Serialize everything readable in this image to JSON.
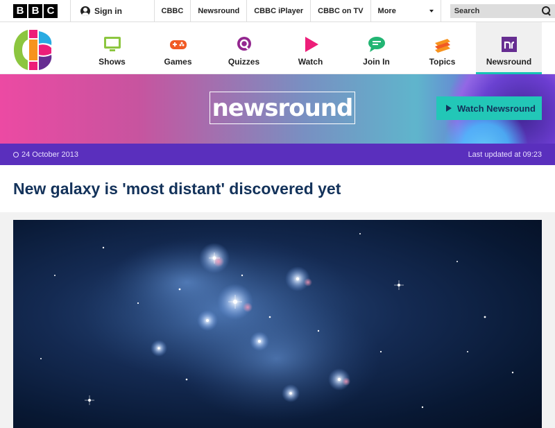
{
  "bbc": {
    "letters": [
      "B",
      "B",
      "C"
    ],
    "signin": "Sign in"
  },
  "topnav": [
    "CBBC",
    "Newsround",
    "CBBC iPlayer",
    "CBBC on TV"
  ],
  "more_label": "More",
  "search_label": "Search",
  "cbbc_nav": [
    {
      "label": "Shows",
      "icon": "tv-icon",
      "color": "#8cc63f"
    },
    {
      "label": "Games",
      "icon": "gamepad-icon",
      "color": "#f15a24"
    },
    {
      "label": "Quizzes",
      "icon": "quiz-icon",
      "color": "#93278f"
    },
    {
      "label": "Watch",
      "icon": "play-icon",
      "color": "#ed1e79"
    },
    {
      "label": "Join In",
      "icon": "chat-icon",
      "color": "#22b573"
    },
    {
      "label": "Topics",
      "icon": "layers-icon",
      "color": "#f7931e"
    },
    {
      "label": "Newsround",
      "icon": "newsround-icon",
      "color": "#662d91"
    }
  ],
  "banner": {
    "logo_text": "newsround",
    "watch_label": "Watch Newsround"
  },
  "date_bar": {
    "date": "24 October 2013",
    "updated": "Last updated at 09:23"
  },
  "article": {
    "headline": "New galaxy is 'most distant' discovered yet"
  },
  "colors": {
    "accent": "#22c7b7",
    "date_bar": "#5a2fbd",
    "headline": "#13325a"
  }
}
